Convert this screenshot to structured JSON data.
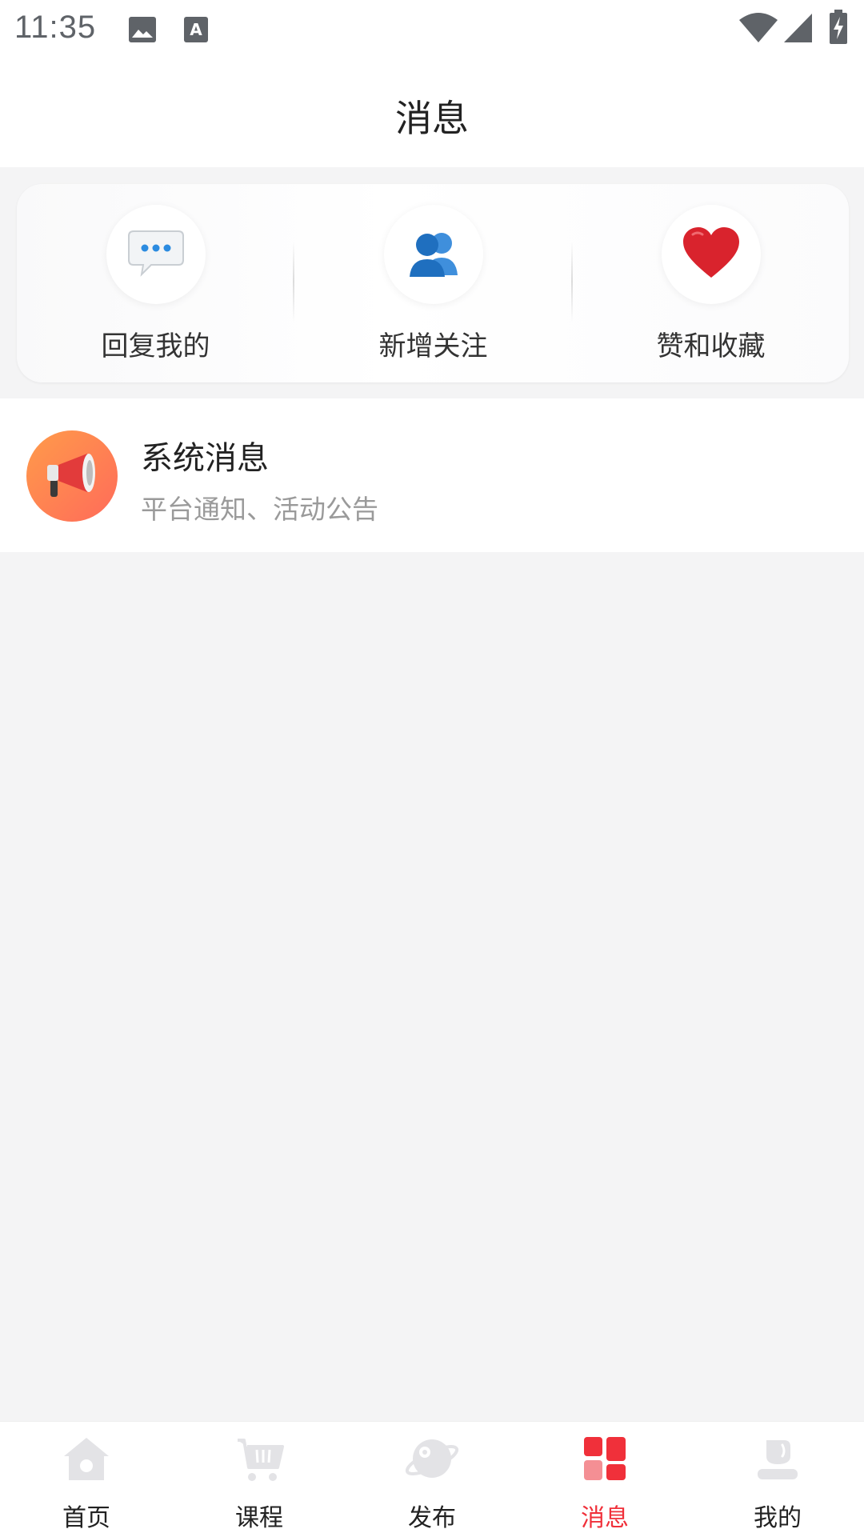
{
  "status_bar": {
    "time": "11:35",
    "icons": [
      "image-icon",
      "text-a-icon",
      "wifi-icon",
      "signal-icon",
      "battery-charging-icon"
    ]
  },
  "header": {
    "title": "消息"
  },
  "quick_actions": [
    {
      "label": "回复我的",
      "icon": "speech-bubble-icon"
    },
    {
      "label": "新增关注",
      "icon": "users-icon"
    },
    {
      "label": "赞和收藏",
      "icon": "heart-icon"
    }
  ],
  "messages": [
    {
      "title": "系统消息",
      "subtitle": "平台通知、活动公告",
      "icon": "megaphone-icon"
    }
  ],
  "tabbar": {
    "active_index": 3,
    "active_color": "#f0303a",
    "items": [
      {
        "label": "首页",
        "icon": "home-icon"
      },
      {
        "label": "课程",
        "icon": "cart-icon"
      },
      {
        "label": "发布",
        "icon": "planet-icon"
      },
      {
        "label": "消息",
        "icon": "grid-icon"
      },
      {
        "label": "我的",
        "icon": "user-icon"
      }
    ]
  }
}
